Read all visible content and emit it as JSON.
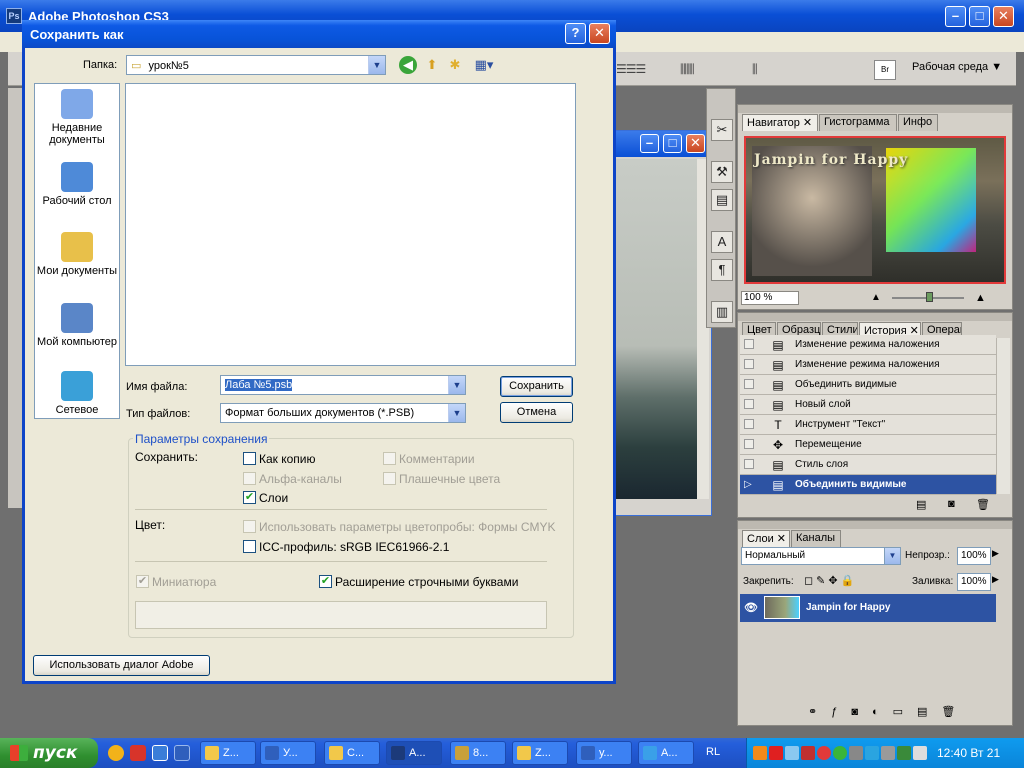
{
  "photoshop": {
    "title": "Adobe Photoshop CS3",
    "workspace_label": "Рабочая среда",
    "panels": {
      "navigator": {
        "tabs": [
          "Навигатор",
          "Гистограмма",
          "Инфо"
        ],
        "zoom": "100 %",
        "preview_text": "Jampin    for  Happy"
      },
      "history": {
        "tabs": [
          "Цвет",
          "Образцы",
          "Стили",
          "История",
          "Операции"
        ],
        "items": [
          {
            "label": "Изменение режима наложения",
            "icon": "document-icon"
          },
          {
            "label": "Изменение режима наложения",
            "icon": "document-icon"
          },
          {
            "label": "Объединить видимые",
            "icon": "document-icon"
          },
          {
            "label": "Новый слой",
            "icon": "document-icon"
          },
          {
            "label": "Инструмент \"Текст\"",
            "icon": "text-tool-icon"
          },
          {
            "label": "Перемещение",
            "icon": "move-tool-icon"
          },
          {
            "label": "Стиль слоя",
            "icon": "document-icon"
          },
          {
            "label": "Объединить видимые",
            "icon": "document-icon",
            "selected": true
          }
        ]
      },
      "layers": {
        "tabs": [
          "Слои",
          "Каналы"
        ],
        "blend_mode": "Нормальный",
        "opacity_label": "Непрозр.:",
        "opacity_value": "100%",
        "lock_label": "Закрепить:",
        "fill_label": "Заливка:",
        "fill_value": "100%",
        "layer_name": "Jampin      for  Happy"
      }
    }
  },
  "dialog": {
    "title": "Сохранить как",
    "folder_label": "Папка:",
    "folder_value": "урок№5",
    "places": [
      {
        "label": "Недавние документы",
        "icon": "recent-documents-icon"
      },
      {
        "label": "Рабочий стол",
        "icon": "desktop-icon"
      },
      {
        "label": "Мои документы",
        "icon": "my-documents-icon"
      },
      {
        "label": "Мой компьютер",
        "icon": "my-computer-icon"
      },
      {
        "label": "Сетевое",
        "icon": "network-icon"
      }
    ],
    "filename_label": "Имя файла:",
    "filename_value": "Лаба №5.psb",
    "filetype_label": "Тип файлов:",
    "filetype_value": "Формат больших документов (*.PSB)",
    "save_button": "Сохранить",
    "cancel_button": "Отмена",
    "save_options_title": "Параметры сохранения",
    "save_label": "Сохранить:",
    "options": {
      "as_copy": {
        "label": "Как копию",
        "checked": false,
        "enabled": true
      },
      "comments": {
        "label": "Комментарии",
        "checked": false,
        "enabled": false
      },
      "alpha_channels": {
        "label": "Альфа-каналы",
        "checked": false,
        "enabled": false
      },
      "spot_colors": {
        "label": "Плашечные цвета",
        "checked": false,
        "enabled": false
      },
      "layers": {
        "label": "Слои",
        "checked": true,
        "enabled": true
      }
    },
    "color_label": "Цвет:",
    "proof_setup": {
      "label": "Использовать параметры цветопробы:  Формы CMYK",
      "checked": false,
      "enabled": false
    },
    "icc_profile": {
      "label": "ICC-профиль:  sRGB IEC61966-2.1",
      "checked": false,
      "enabled": true
    },
    "thumbnail": {
      "label": "Миниатюра",
      "checked": true,
      "enabled": false
    },
    "lowercase_ext": {
      "label": "Расширение строчными буквами",
      "checked": true,
      "enabled": true
    },
    "adobe_dialog_button": "Использовать диалог Adobe"
  },
  "taskbar": {
    "start_label": "пуск",
    "tasks": [
      {
        "label": "Z...",
        "icon": "folder-icon"
      },
      {
        "label": "У...",
        "icon": "word-icon"
      },
      {
        "label": "С...",
        "icon": "folder-icon"
      },
      {
        "label": "А...",
        "icon": "photoshop-icon",
        "active": true
      },
      {
        "label": "8...",
        "icon": "app-icon"
      },
      {
        "label": "Z...",
        "icon": "folder-icon"
      },
      {
        "label": "у...",
        "icon": "word-icon"
      },
      {
        "label": "А...",
        "icon": "ie-icon"
      }
    ],
    "language": "RL",
    "clock": "12:40 Вт 21"
  }
}
